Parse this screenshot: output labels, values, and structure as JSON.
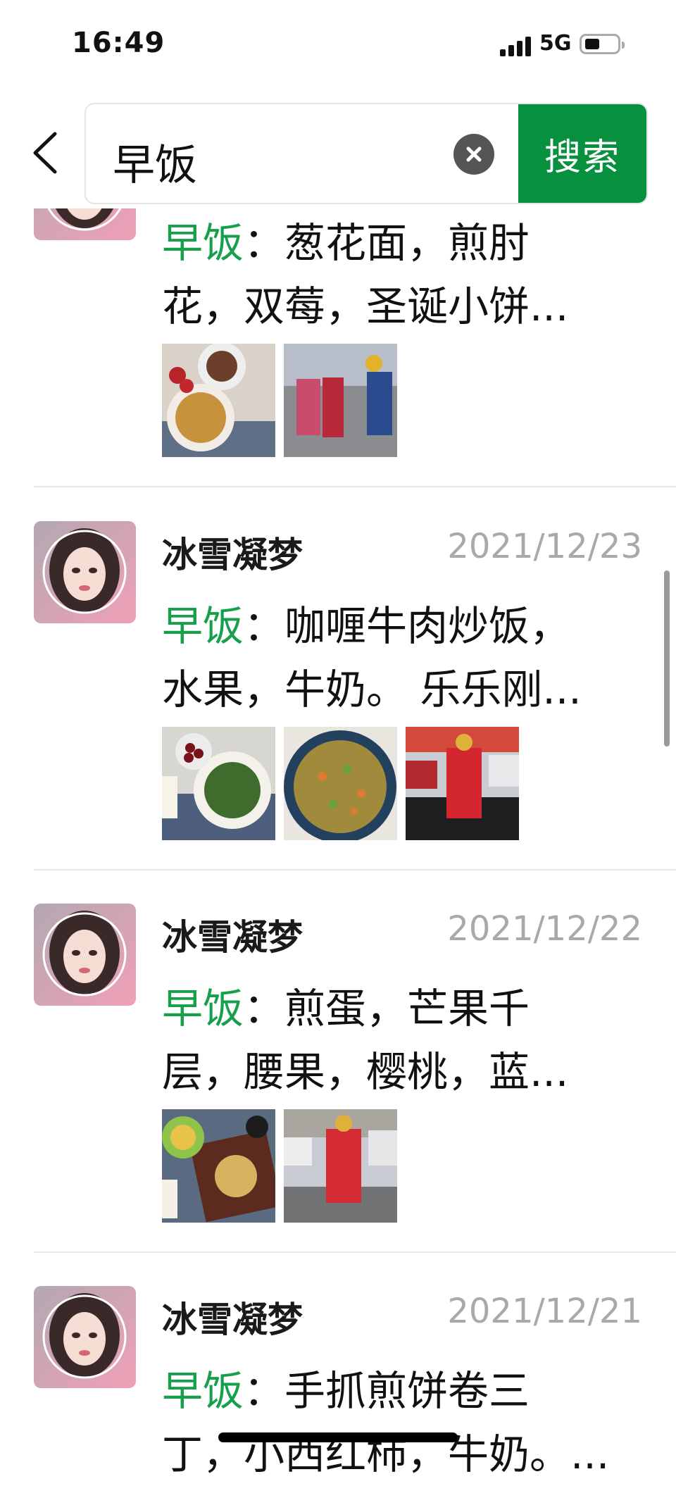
{
  "status_bar": {
    "time": "16:49",
    "network": "5G"
  },
  "search": {
    "query": "早饭",
    "button_label": "搜索"
  },
  "keyword": "早饭",
  "separator": "：",
  "entries": [
    {
      "user": "",
      "date": "",
      "line1": "葱花面，煎肘",
      "line2": "花，双莓，圣诞小饼..."
    },
    {
      "user": "冰雪凝梦",
      "date": "2021/12/23",
      "line1": "咖喱牛肉炒饭，",
      "line2": "水果，牛奶。 乐乐刚..."
    },
    {
      "user": "冰雪凝梦",
      "date": "2021/12/22",
      "line1": "煎蛋，芒果千",
      "line2": "层，腰果，樱桃，蓝..."
    },
    {
      "user": "冰雪凝梦",
      "date": "2021/12/21",
      "line1": "手抓煎饼卷三",
      "line2": "丁，小西红柿，牛奶。..."
    }
  ],
  "colors": {
    "accent_green": "#07913f",
    "keyword_green": "#17a04c",
    "date_gray": "#a9a9a9"
  },
  "icons": [
    "back-chevron-icon",
    "clear-icon",
    "signal-icon",
    "battery-icon"
  ]
}
